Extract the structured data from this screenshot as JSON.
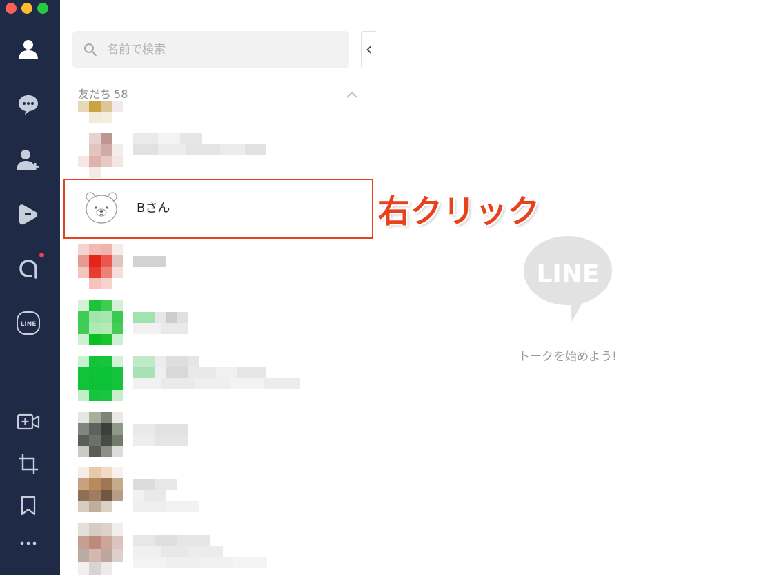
{
  "window": {
    "buttons": [
      "close",
      "minimize",
      "zoom"
    ]
  },
  "nav": {
    "items": [
      {
        "icon": "person-icon",
        "active": true
      },
      {
        "icon": "chat-bubble-icon",
        "active": false
      },
      {
        "icon": "add-friend-icon",
        "active": false
      },
      {
        "icon": "timeline-icon",
        "active": false
      },
      {
        "icon": "official-account-icon",
        "active": false,
        "badge": true
      },
      {
        "icon": "line-icon",
        "label": "LINE",
        "active": false
      },
      {
        "icon": "video-call-icon",
        "active": false
      },
      {
        "icon": "crop-icon",
        "active": false
      },
      {
        "icon": "bookmark-icon",
        "active": false
      },
      {
        "icon": "more-icon",
        "active": false
      }
    ],
    "colors": {
      "background": "#1f2a47",
      "icon": "#c7cedb",
      "active": "#ffffff",
      "badge": "#ff3b4a"
    }
  },
  "search": {
    "placeholder": "名前で検索"
  },
  "friends": {
    "section_label": "友だち",
    "count": "58",
    "selected_name": "Bさん"
  },
  "annotation": {
    "text": "右クリック",
    "color": "#e8411e"
  },
  "chat": {
    "logo_text": "LINE",
    "empty_message": "トークを始めよう!"
  }
}
